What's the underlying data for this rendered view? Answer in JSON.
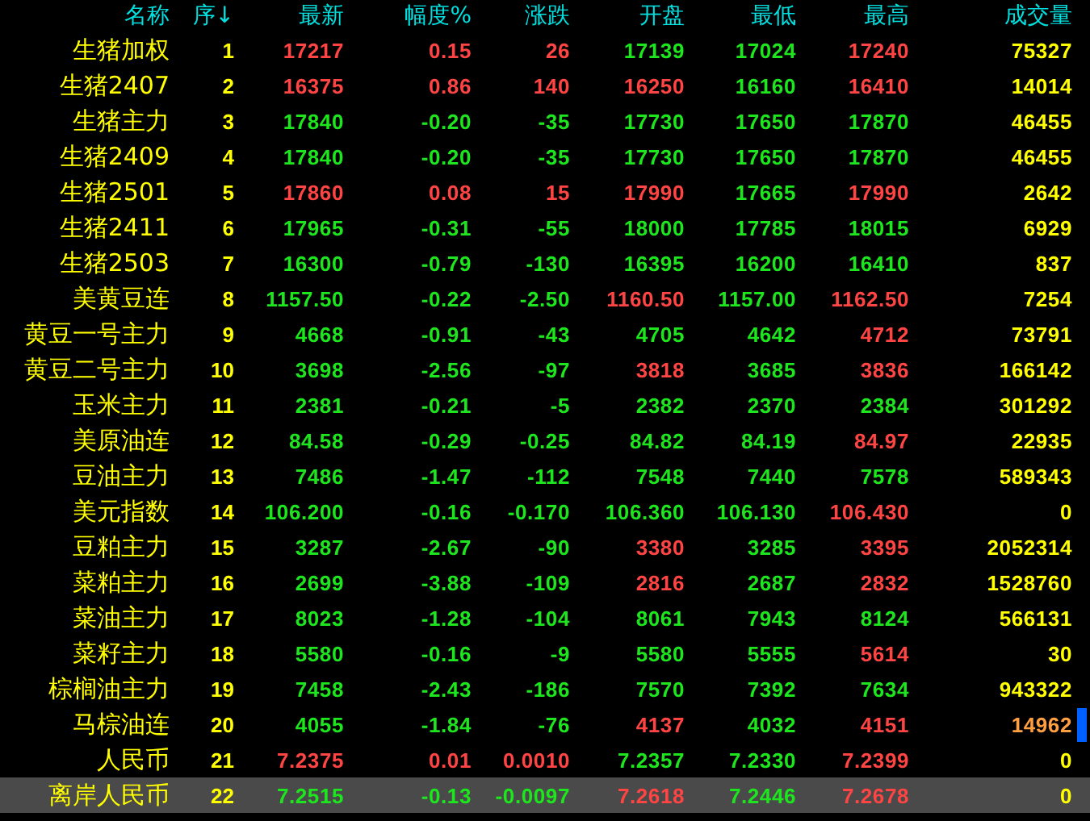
{
  "columns": [
    "名称",
    "序↓",
    "最新",
    "幅度%",
    "涨跌",
    "开盘",
    "最低",
    "最高",
    "成交量"
  ],
  "rows": [
    {
      "name": "生猪加权",
      "no": "1",
      "selected": false,
      "marker": false,
      "values": [
        {
          "text": "17217",
          "up": true
        },
        {
          "text": "0.15",
          "up": true
        },
        {
          "text": "26",
          "up": true
        },
        {
          "text": "17139",
          "up": false
        },
        {
          "text": "17024",
          "up": false
        },
        {
          "text": "17240",
          "up": true
        }
      ],
      "volume": {
        "text": "75327",
        "highlight": false
      }
    },
    {
      "name": "生猪2407",
      "no": "2",
      "selected": false,
      "marker": false,
      "values": [
        {
          "text": "16375",
          "up": true
        },
        {
          "text": "0.86",
          "up": true
        },
        {
          "text": "140",
          "up": true
        },
        {
          "text": "16250",
          "up": true
        },
        {
          "text": "16160",
          "up": false
        },
        {
          "text": "16410",
          "up": true
        }
      ],
      "volume": {
        "text": "14014",
        "highlight": false
      }
    },
    {
      "name": "生猪主力",
      "no": "3",
      "selected": false,
      "marker": false,
      "values": [
        {
          "text": "17840",
          "up": false
        },
        {
          "text": "-0.20",
          "up": false
        },
        {
          "text": "-35",
          "up": false
        },
        {
          "text": "17730",
          "up": false
        },
        {
          "text": "17650",
          "up": false
        },
        {
          "text": "17870",
          "up": false
        }
      ],
      "volume": {
        "text": "46455",
        "highlight": false
      }
    },
    {
      "name": "生猪2409",
      "no": "4",
      "selected": false,
      "marker": false,
      "values": [
        {
          "text": "17840",
          "up": false
        },
        {
          "text": "-0.20",
          "up": false
        },
        {
          "text": "-35",
          "up": false
        },
        {
          "text": "17730",
          "up": false
        },
        {
          "text": "17650",
          "up": false
        },
        {
          "text": "17870",
          "up": false
        }
      ],
      "volume": {
        "text": "46455",
        "highlight": false
      }
    },
    {
      "name": "生猪2501",
      "no": "5",
      "selected": false,
      "marker": false,
      "values": [
        {
          "text": "17860",
          "up": true
        },
        {
          "text": "0.08",
          "up": true
        },
        {
          "text": "15",
          "up": true
        },
        {
          "text": "17990",
          "up": true
        },
        {
          "text": "17665",
          "up": false
        },
        {
          "text": "17990",
          "up": true
        }
      ],
      "volume": {
        "text": "2642",
        "highlight": false
      }
    },
    {
      "name": "生猪2411",
      "no": "6",
      "selected": false,
      "marker": false,
      "values": [
        {
          "text": "17965",
          "up": false
        },
        {
          "text": "-0.31",
          "up": false
        },
        {
          "text": "-55",
          "up": false
        },
        {
          "text": "18000",
          "up": false
        },
        {
          "text": "17785",
          "up": false
        },
        {
          "text": "18015",
          "up": false
        }
      ],
      "volume": {
        "text": "6929",
        "highlight": false
      }
    },
    {
      "name": "生猪2503",
      "no": "7",
      "selected": false,
      "marker": false,
      "values": [
        {
          "text": "16300",
          "up": false
        },
        {
          "text": "-0.79",
          "up": false
        },
        {
          "text": "-130",
          "up": false
        },
        {
          "text": "16395",
          "up": false
        },
        {
          "text": "16200",
          "up": false
        },
        {
          "text": "16410",
          "up": false
        }
      ],
      "volume": {
        "text": "837",
        "highlight": false
      }
    },
    {
      "name": "美黄豆连",
      "no": "8",
      "selected": false,
      "marker": false,
      "values": [
        {
          "text": "1157.50",
          "up": false
        },
        {
          "text": "-0.22",
          "up": false
        },
        {
          "text": "-2.50",
          "up": false
        },
        {
          "text": "1160.50",
          "up": true
        },
        {
          "text": "1157.00",
          "up": false
        },
        {
          "text": "1162.50",
          "up": true
        }
      ],
      "volume": {
        "text": "7254",
        "highlight": false
      }
    },
    {
      "name": "黄豆一号主力",
      "no": "9",
      "selected": false,
      "marker": false,
      "values": [
        {
          "text": "4668",
          "up": false
        },
        {
          "text": "-0.91",
          "up": false
        },
        {
          "text": "-43",
          "up": false
        },
        {
          "text": "4705",
          "up": false
        },
        {
          "text": "4642",
          "up": false
        },
        {
          "text": "4712",
          "up": true
        }
      ],
      "volume": {
        "text": "73791",
        "highlight": false
      }
    },
    {
      "name": "黄豆二号主力",
      "no": "10",
      "selected": false,
      "marker": false,
      "values": [
        {
          "text": "3698",
          "up": false
        },
        {
          "text": "-2.56",
          "up": false
        },
        {
          "text": "-97",
          "up": false
        },
        {
          "text": "3818",
          "up": true
        },
        {
          "text": "3685",
          "up": false
        },
        {
          "text": "3836",
          "up": true
        }
      ],
      "volume": {
        "text": "166142",
        "highlight": false
      }
    },
    {
      "name": "玉米主力",
      "no": "11",
      "selected": false,
      "marker": false,
      "values": [
        {
          "text": "2381",
          "up": false
        },
        {
          "text": "-0.21",
          "up": false
        },
        {
          "text": "-5",
          "up": false
        },
        {
          "text": "2382",
          "up": false
        },
        {
          "text": "2370",
          "up": false
        },
        {
          "text": "2384",
          "up": false
        }
      ],
      "volume": {
        "text": "301292",
        "highlight": false
      }
    },
    {
      "name": "美原油连",
      "no": "12",
      "selected": false,
      "marker": false,
      "values": [
        {
          "text": "84.58",
          "up": false
        },
        {
          "text": "-0.29",
          "up": false
        },
        {
          "text": "-0.25",
          "up": false
        },
        {
          "text": "84.82",
          "up": false
        },
        {
          "text": "84.19",
          "up": false
        },
        {
          "text": "84.97",
          "up": true
        }
      ],
      "volume": {
        "text": "22935",
        "highlight": false
      }
    },
    {
      "name": "豆油主力",
      "no": "13",
      "selected": false,
      "marker": false,
      "values": [
        {
          "text": "7486",
          "up": false
        },
        {
          "text": "-1.47",
          "up": false
        },
        {
          "text": "-112",
          "up": false
        },
        {
          "text": "7548",
          "up": false
        },
        {
          "text": "7440",
          "up": false
        },
        {
          "text": "7578",
          "up": false
        }
      ],
      "volume": {
        "text": "589343",
        "highlight": false
      }
    },
    {
      "name": "美元指数",
      "no": "14",
      "selected": false,
      "marker": false,
      "values": [
        {
          "text": "106.200",
          "up": false
        },
        {
          "text": "-0.16",
          "up": false
        },
        {
          "text": "-0.170",
          "up": false
        },
        {
          "text": "106.360",
          "up": false
        },
        {
          "text": "106.130",
          "up": false
        },
        {
          "text": "106.430",
          "up": true
        }
      ],
      "volume": {
        "text": "0",
        "highlight": false
      }
    },
    {
      "name": "豆粕主力",
      "no": "15",
      "selected": false,
      "marker": false,
      "values": [
        {
          "text": "3287",
          "up": false
        },
        {
          "text": "-2.67",
          "up": false
        },
        {
          "text": "-90",
          "up": false
        },
        {
          "text": "3380",
          "up": true
        },
        {
          "text": "3285",
          "up": false
        },
        {
          "text": "3395",
          "up": true
        }
      ],
      "volume": {
        "text": "2052314",
        "highlight": false
      }
    },
    {
      "name": "菜粕主力",
      "no": "16",
      "selected": false,
      "marker": false,
      "values": [
        {
          "text": "2699",
          "up": false
        },
        {
          "text": "-3.88",
          "up": false
        },
        {
          "text": "-109",
          "up": false
        },
        {
          "text": "2816",
          "up": true
        },
        {
          "text": "2687",
          "up": false
        },
        {
          "text": "2832",
          "up": true
        }
      ],
      "volume": {
        "text": "1528760",
        "highlight": false
      }
    },
    {
      "name": "菜油主力",
      "no": "17",
      "selected": false,
      "marker": false,
      "values": [
        {
          "text": "8023",
          "up": false
        },
        {
          "text": "-1.28",
          "up": false
        },
        {
          "text": "-104",
          "up": false
        },
        {
          "text": "8061",
          "up": false
        },
        {
          "text": "7943",
          "up": false
        },
        {
          "text": "8124",
          "up": false
        }
      ],
      "volume": {
        "text": "566131",
        "highlight": false
      }
    },
    {
      "name": "菜籽主力",
      "no": "18",
      "selected": false,
      "marker": false,
      "values": [
        {
          "text": "5580",
          "up": false
        },
        {
          "text": "-0.16",
          "up": false
        },
        {
          "text": "-9",
          "up": false
        },
        {
          "text": "5580",
          "up": false
        },
        {
          "text": "5555",
          "up": false
        },
        {
          "text": "5614",
          "up": true
        }
      ],
      "volume": {
        "text": "30",
        "highlight": false
      }
    },
    {
      "name": "棕榈油主力",
      "no": "19",
      "selected": false,
      "marker": false,
      "values": [
        {
          "text": "7458",
          "up": false
        },
        {
          "text": "-2.43",
          "up": false
        },
        {
          "text": "-186",
          "up": false
        },
        {
          "text": "7570",
          "up": false
        },
        {
          "text": "7392",
          "up": false
        },
        {
          "text": "7634",
          "up": false
        }
      ],
      "volume": {
        "text": "943322",
        "highlight": false
      }
    },
    {
      "name": "马棕油连",
      "no": "20",
      "selected": false,
      "marker": true,
      "values": [
        {
          "text": "4055",
          "up": false
        },
        {
          "text": "-1.84",
          "up": false
        },
        {
          "text": "-76",
          "up": false
        },
        {
          "text": "4137",
          "up": true
        },
        {
          "text": "4032",
          "up": false
        },
        {
          "text": "4151",
          "up": true
        }
      ],
      "volume": {
        "text": "14962",
        "highlight": true
      }
    },
    {
      "name": "人民币",
      "no": "21",
      "selected": false,
      "marker": false,
      "values": [
        {
          "text": "7.2375",
          "up": true
        },
        {
          "text": "0.01",
          "up": true
        },
        {
          "text": "0.0010",
          "up": true
        },
        {
          "text": "7.2357",
          "up": false
        },
        {
          "text": "7.2330",
          "up": false
        },
        {
          "text": "7.2399",
          "up": true
        }
      ],
      "volume": {
        "text": "0",
        "highlight": false
      }
    },
    {
      "name": "离岸人民币",
      "no": "22",
      "selected": true,
      "marker": false,
      "values": [
        {
          "text": "7.2515",
          "up": false
        },
        {
          "text": "-0.13",
          "up": false
        },
        {
          "text": "-0.0097",
          "up": false
        },
        {
          "text": "7.2618",
          "up": true
        },
        {
          "text": "7.2446",
          "up": false
        },
        {
          "text": "7.2678",
          "up": true
        }
      ],
      "volume": {
        "text": "0",
        "highlight": false
      }
    }
  ]
}
